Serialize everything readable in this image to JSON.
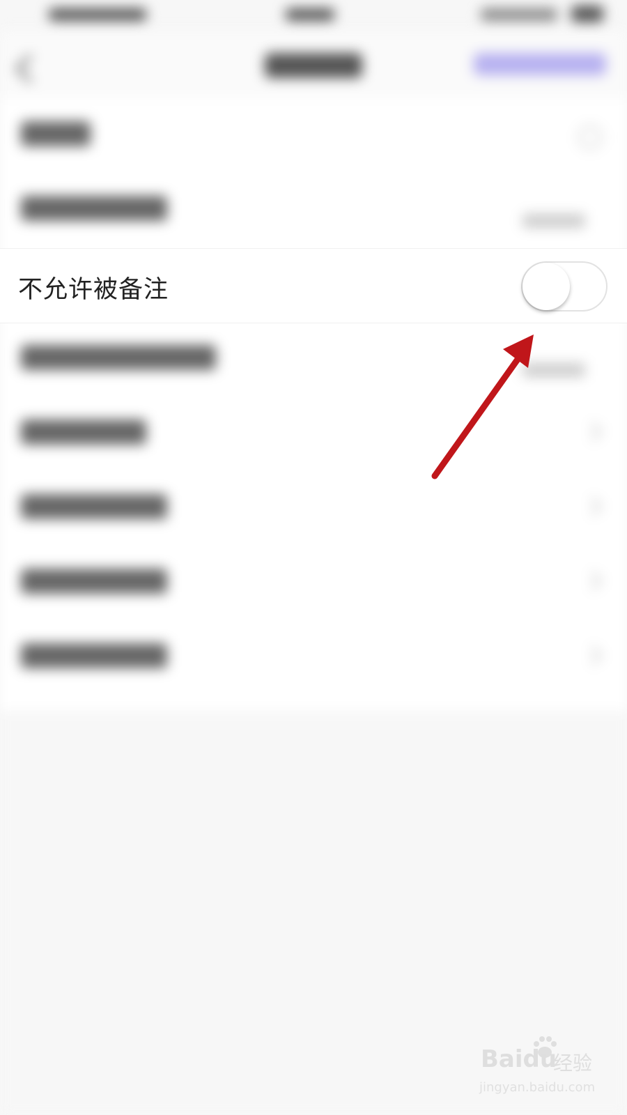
{
  "settings_row": {
    "label": "不允许被备注",
    "toggle_on": false
  },
  "watermark": {
    "brand": "Baidu",
    "product": "经验",
    "url": "jingyan.baidu.com"
  },
  "colors": {
    "annotation_arrow": "#c0161a",
    "nav_accent": "#b7b1f0"
  }
}
